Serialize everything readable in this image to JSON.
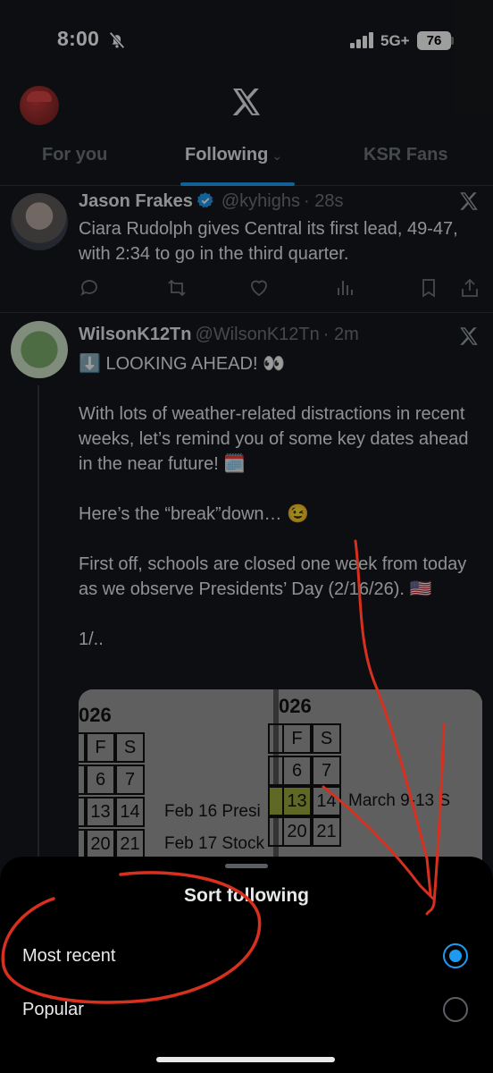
{
  "status_bar": {
    "time": "8:00",
    "network": "5G+",
    "battery": "76"
  },
  "tabs": [
    {
      "label": "For you"
    },
    {
      "label": "Following"
    },
    {
      "label": "KSR Fans"
    }
  ],
  "tweets": [
    {
      "name": "Jason Frakes",
      "handle": "@kyhighs",
      "age": "· 28s",
      "text": "Ciara Rudolph gives Central its first lead, 49-47, with 2:34 to go in the third quarter."
    },
    {
      "name": "WilsonK12Tn",
      "handle": "@WilsonK12Tn",
      "age": "· 2m",
      "text": "⬇️ LOOKING AHEAD! 👀\n\nWith lots of weather-related distractions in recent weeks, let’s remind you of some key dates ahead in the near future! 🗓️\n\nHere’s the “break”down… 😉\n\nFirst off, schools are closed one week from today as we observe Presidents’ Day (2/16/26). 🇺🇸\n\n1/..",
      "calendar": {
        "left_year": "026",
        "right_year": "026",
        "left_headers": [
          "F",
          "S"
        ],
        "left_rows": [
          [
            "6",
            "7"
          ],
          [
            "13",
            "14"
          ],
          [
            "20",
            "21"
          ]
        ],
        "left_notes": [
          "Feb 16 Presi",
          "Feb 17 Stock"
        ],
        "right_headers": [
          "F",
          "S"
        ],
        "right_rows": [
          [
            "6",
            "7"
          ],
          [
            "13",
            "14"
          ],
          [
            "20",
            "21"
          ]
        ],
        "right_note": "March 9-13 S"
      }
    }
  ],
  "sheet": {
    "title": "Sort following",
    "options": [
      {
        "label": "Most recent",
        "selected": true
      },
      {
        "label": "Popular",
        "selected": false
      }
    ]
  },
  "colors": {
    "accent": "#1d9bf0",
    "annotation": "#d8301f",
    "background": "#15181c",
    "sheet": "#000000"
  }
}
